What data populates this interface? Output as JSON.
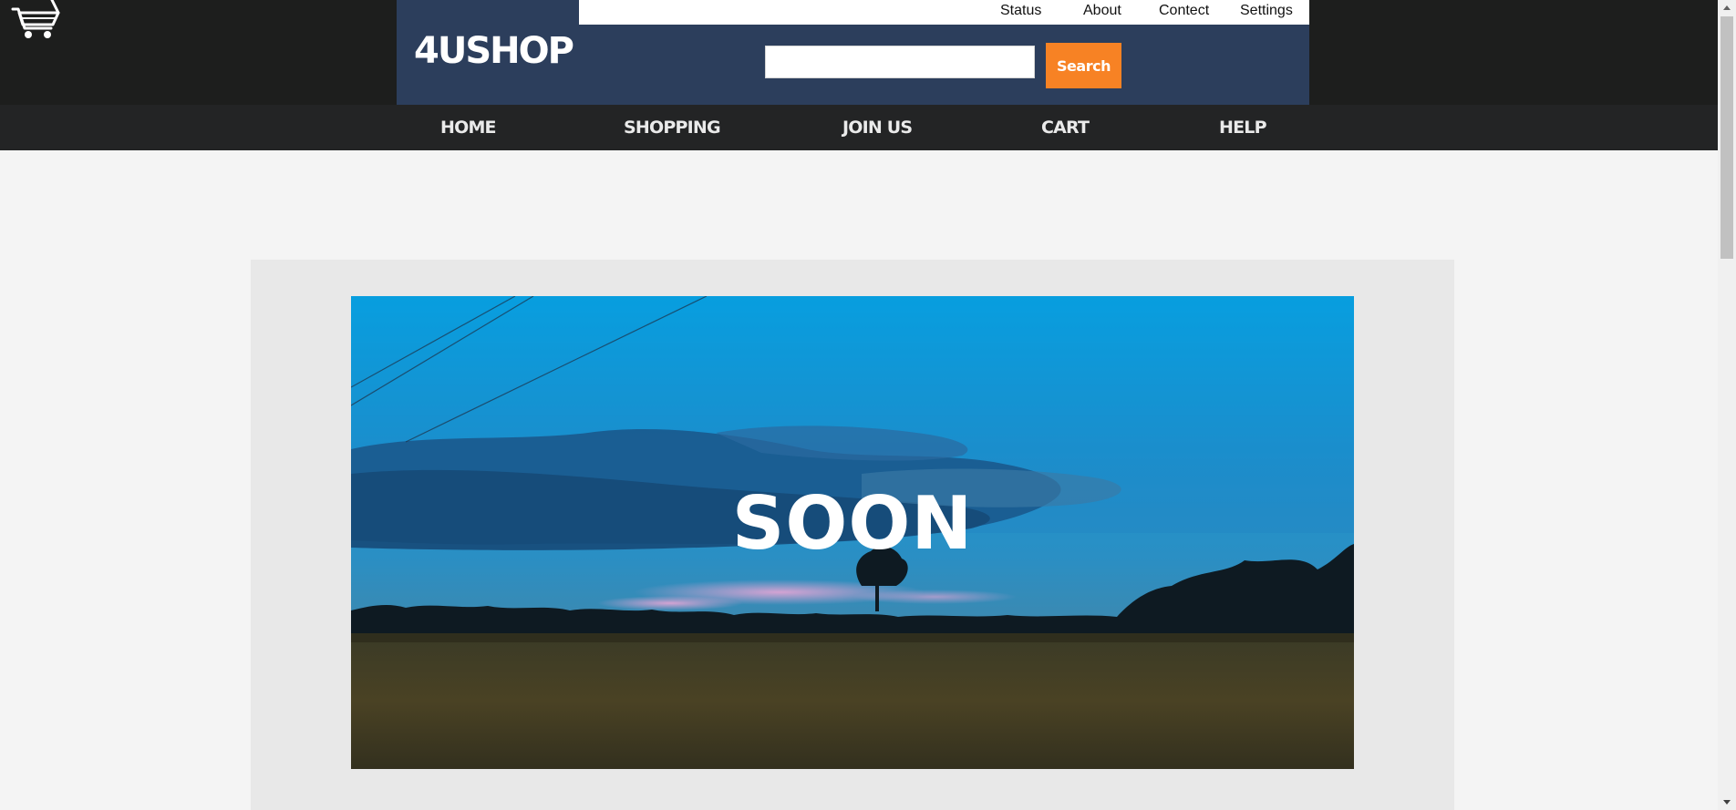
{
  "brand": {
    "name": "4USHOP"
  },
  "utility_links": [
    {
      "label": "Status"
    },
    {
      "label": "About"
    },
    {
      "label": "Contect"
    },
    {
      "label": "Settings"
    }
  ],
  "search": {
    "value": "",
    "placeholder": "",
    "button_label": "Search"
  },
  "nav": [
    {
      "label": "HOME"
    },
    {
      "label": "SHOPPING"
    },
    {
      "label": "JOIN US"
    },
    {
      "label": "CART"
    },
    {
      "label": "HELP"
    }
  ],
  "hero": {
    "text": "SOON"
  },
  "icons": {
    "logo": "shopping-cart-icon"
  },
  "colors": {
    "topbar": "#1d1e1d",
    "brand_panel": "#2c3e5c",
    "search_button": "#f78224",
    "nav_bar": "#232425",
    "page_bg": "#f4f4f4",
    "hero_frame": "#e8e8e8"
  }
}
